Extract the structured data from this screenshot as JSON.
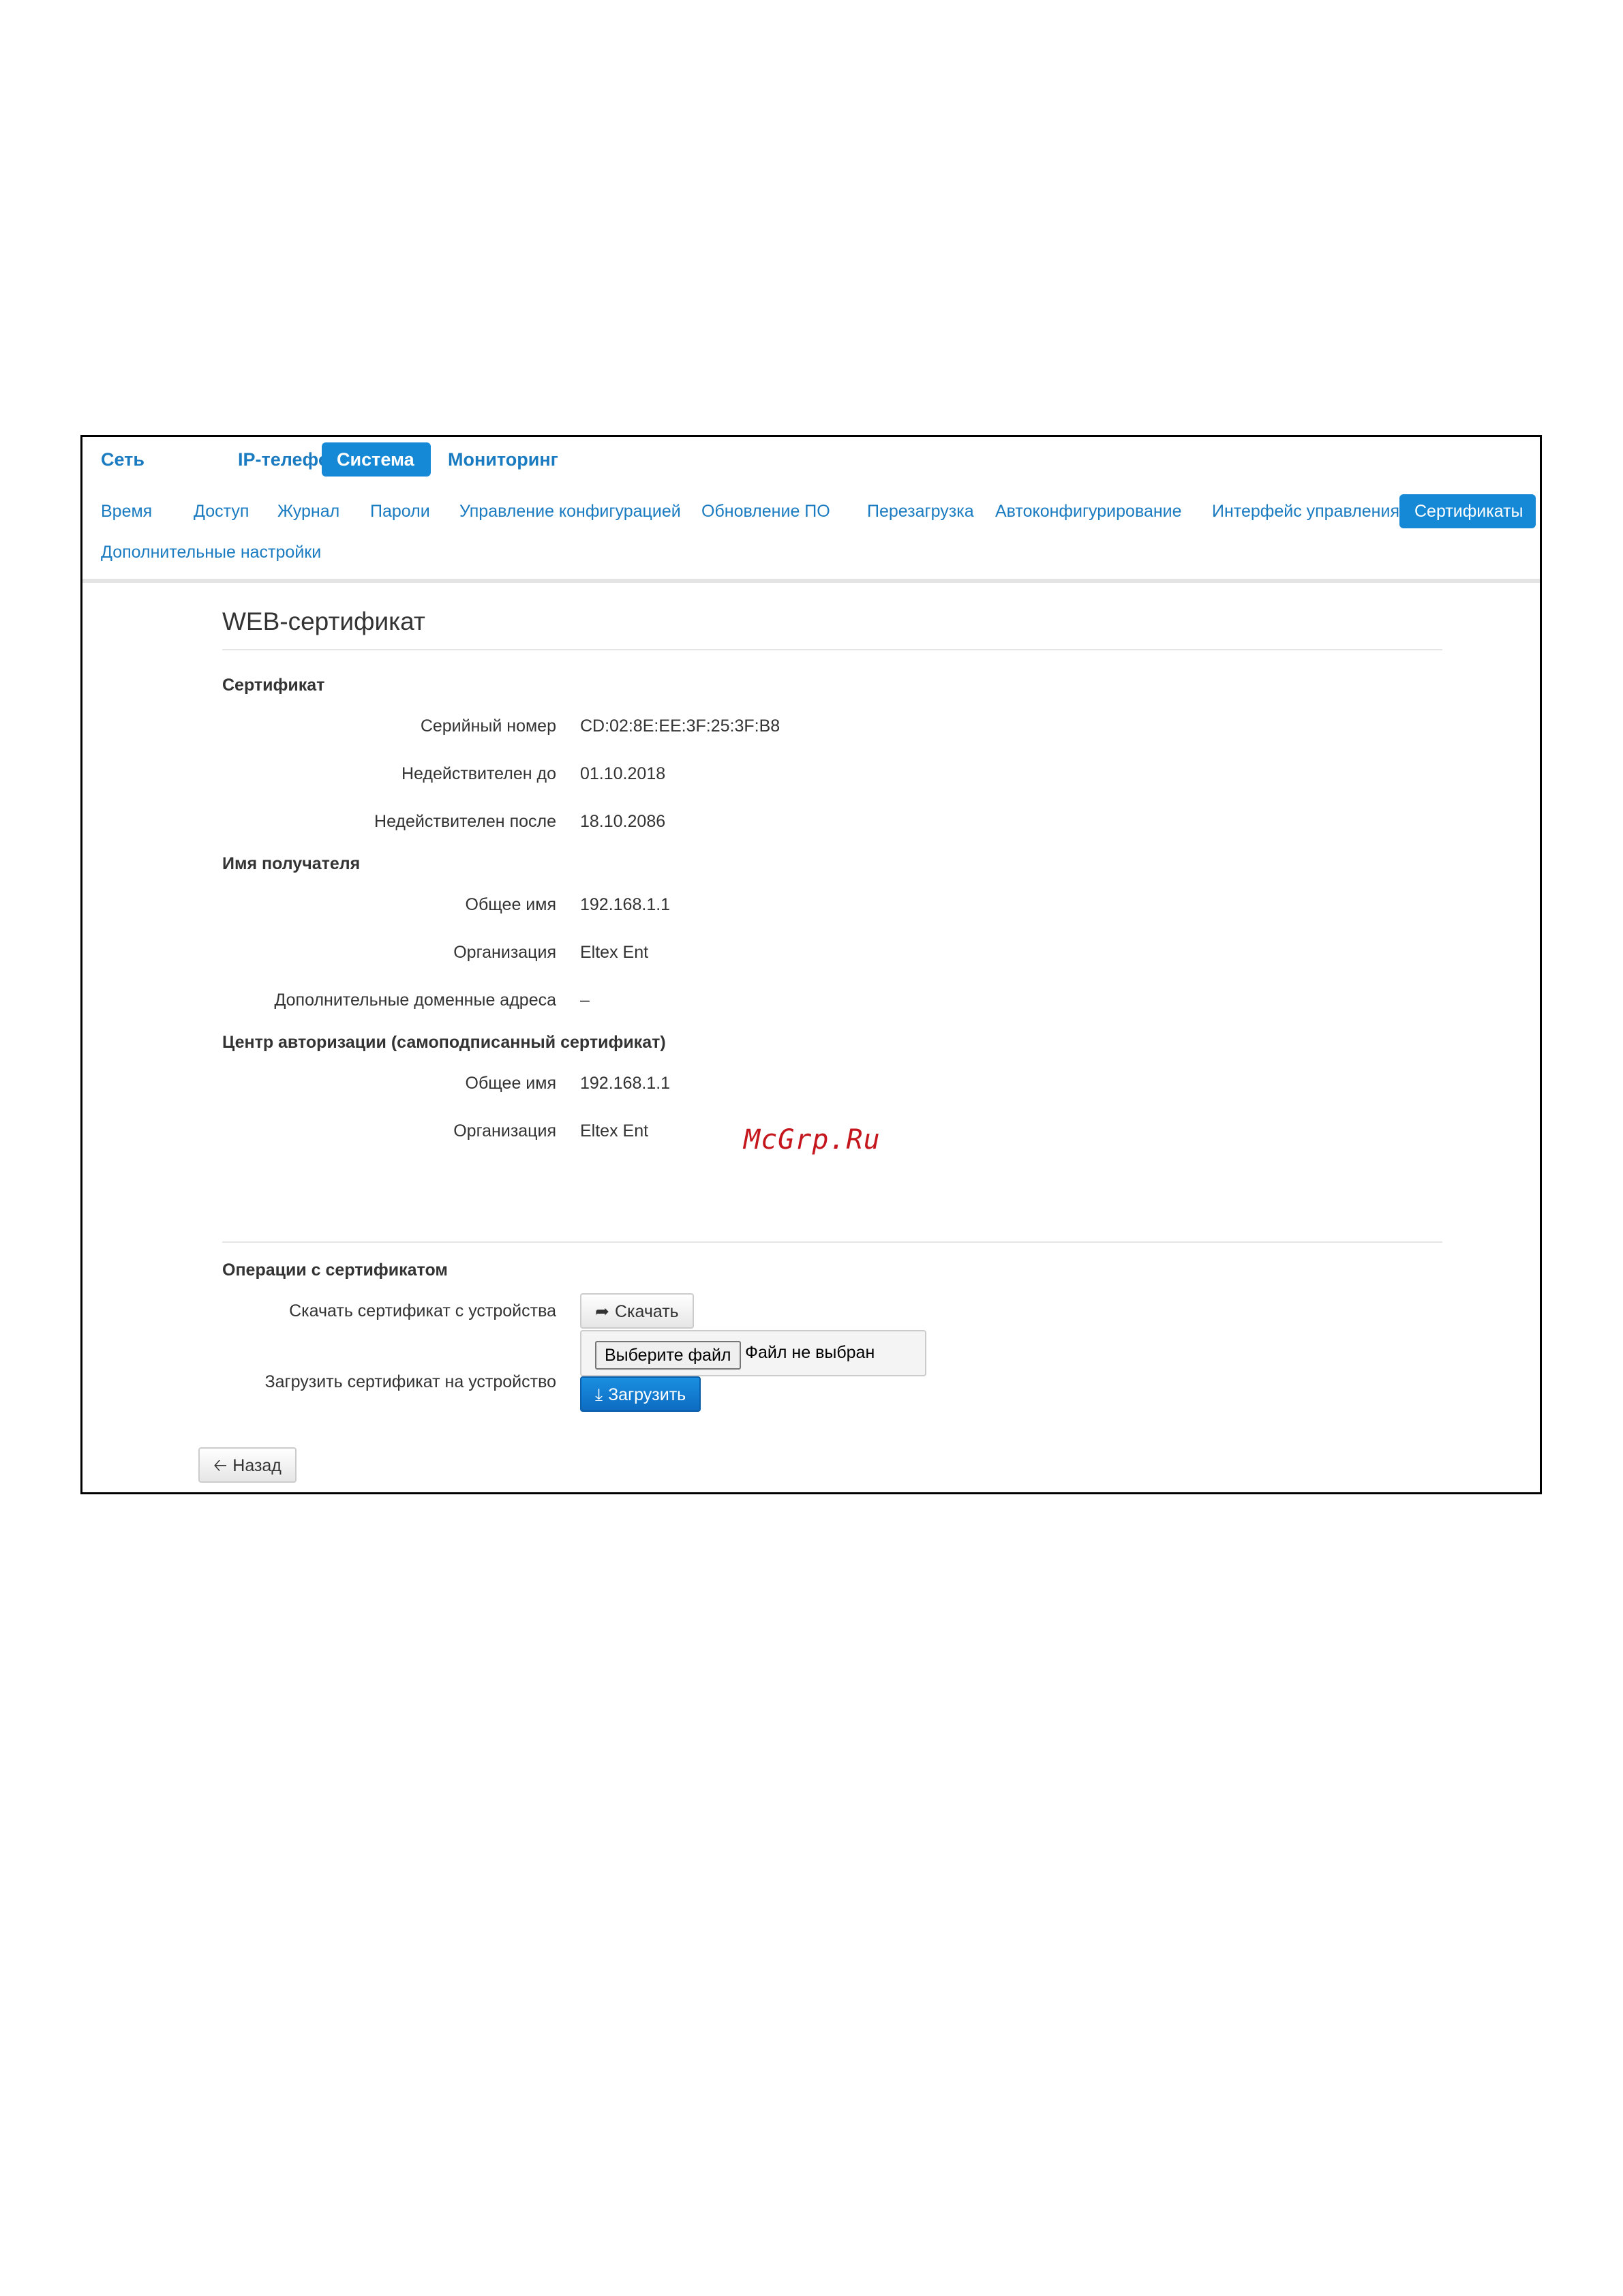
{
  "main_nav": [
    {
      "label": "Сеть",
      "active": false
    },
    {
      "label": "IP-телефония",
      "active": false
    },
    {
      "label": "Система",
      "active": true
    },
    {
      "label": "Мониторинг",
      "active": false
    }
  ],
  "sub_nav": [
    {
      "label": "Время",
      "active": false
    },
    {
      "label": "Доступ",
      "active": false
    },
    {
      "label": "Журнал",
      "active": false
    },
    {
      "label": "Пароли",
      "active": false
    },
    {
      "label": "Управление конфигурацией",
      "active": false
    },
    {
      "label": "Обновление ПО",
      "active": false
    },
    {
      "label": "Перезагрузка",
      "active": false
    },
    {
      "label": "Автоконфигурирование",
      "active": false
    },
    {
      "label": "Интерфейс управления",
      "active": false
    },
    {
      "label": "Сертификаты",
      "active": true
    },
    {
      "label": "Дополнительные настройки",
      "active": false
    }
  ],
  "page": {
    "title": "WEB-сертификат"
  },
  "certificate": {
    "header": "Сертификат",
    "serial_label": "Серийный номер",
    "serial_value": "CD:02:8E:EE:3F:25:3F:B8",
    "not_before_label": "Недействителен до",
    "not_before_value": "01.10.2018",
    "not_after_label": "Недействителен после",
    "not_after_value": "18.10.2086"
  },
  "subject": {
    "header": "Имя получателя",
    "cn_label": "Общее имя",
    "cn_value": "192.168.1.1",
    "org_label": "Организация",
    "org_value": "Eltex Ent",
    "san_label": "Дополнительные доменные адреса",
    "san_value": "–"
  },
  "issuer": {
    "header": "Центр авторизации (самоподписанный сертификат)",
    "cn_label": "Общее имя",
    "cn_value": "192.168.1.1",
    "org_label": "Организация",
    "org_value": "Eltex Ent"
  },
  "watermark": "McGrp.Ru",
  "operations": {
    "header": "Операции с сертификатом",
    "download_label": "Скачать сертификат с устройства",
    "download_button": "Скачать",
    "upload_label": "Загрузить сертификат на устройство",
    "choose_file_button": "Выберите файл",
    "file_status": "Файл не выбран",
    "upload_button": "Загрузить"
  },
  "back_button": "Назад",
  "colors": {
    "accent": "#1588d6",
    "link": "#1a7bc1",
    "watermark": "#c4161c"
  }
}
